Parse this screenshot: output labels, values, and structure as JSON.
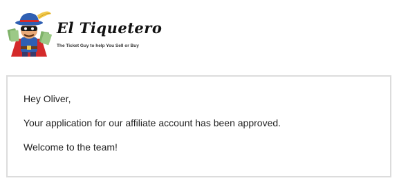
{
  "header": {
    "logo_icon": "bandit-mascot-with-tickets-icon",
    "brand_name": "El Tiquetero",
    "tagline": "The Ticket Guy to help You Sell or Buy"
  },
  "message": {
    "greeting": "Hey Oliver,",
    "body": "Your application for our affiliate account has been approved.",
    "closing": "Welcome to the team!"
  },
  "colors": {
    "card_border": "#dcdcdc",
    "hat_blue": "#2f5fb3",
    "cape_red": "#d42a2a",
    "ticket_green": "#7fb26a",
    "feather_yellow": "#f2c94c"
  }
}
